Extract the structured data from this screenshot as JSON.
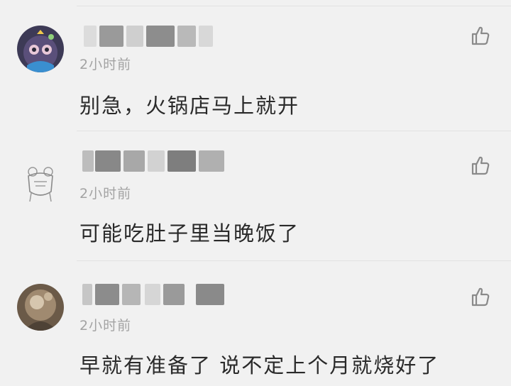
{
  "comments": [
    {
      "time": "2小时前",
      "text": "别急，火锅店马上就开",
      "avatar": "cartoon-avatar"
    },
    {
      "time": "2小时前",
      "text": "可能吃肚子里当晚饭了",
      "avatar": "sketch-avatar"
    },
    {
      "time": "2小时前",
      "text": "早就有准备了 说不定上个月就烧好了",
      "avatar": "photo-avatar"
    }
  ],
  "icons": {
    "like": "thumbs-up-icon"
  },
  "colors": {
    "background": "#f1f1f1",
    "text": "#2a2a2a",
    "timestamp": "#a3a3a3",
    "icon": "#8a8a8a"
  }
}
